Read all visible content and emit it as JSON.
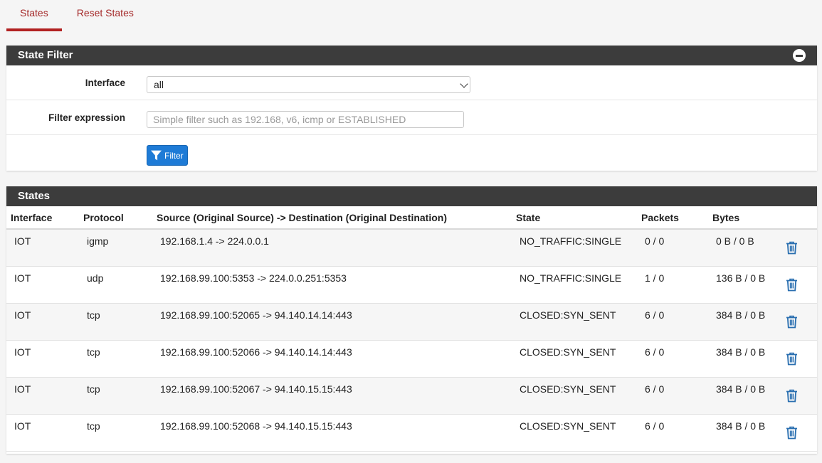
{
  "tabs": [
    {
      "label": "States",
      "active": true
    },
    {
      "label": "Reset States",
      "active": false
    }
  ],
  "filter_panel": {
    "title": "State Filter",
    "interface_label": "Interface",
    "interface_value": "all",
    "expression_label": "Filter expression",
    "expression_value": "",
    "expression_placeholder": "Simple filter such as 192.168, v6, icmp or ESTABLISHED",
    "filter_button": "Filter",
    "collapse_icon": "minus-circle-icon"
  },
  "states_panel": {
    "title": "States",
    "columns": [
      "Interface",
      "Protocol",
      "Source (Original Source) -> Destination (Original Destination)",
      "State",
      "Packets",
      "Bytes"
    ],
    "rows": [
      {
        "interface": "IOT",
        "protocol": "igmp",
        "connection": "192.168.1.4 -> 224.0.0.1",
        "state": "NO_TRAFFIC:SINGLE",
        "packets": "0 / 0",
        "bytes": "0 B / 0 B"
      },
      {
        "interface": "IOT",
        "protocol": "udp",
        "connection": "192.168.99.100:5353 -> 224.0.0.251:5353",
        "state": "NO_TRAFFIC:SINGLE",
        "packets": "1 / 0",
        "bytes": "136 B / 0 B"
      },
      {
        "interface": "IOT",
        "protocol": "tcp",
        "connection": "192.168.99.100:52065 -> 94.140.14.14:443",
        "state": "CLOSED:SYN_SENT",
        "packets": "6 / 0",
        "bytes": "384 B / 0 B"
      },
      {
        "interface": "IOT",
        "protocol": "tcp",
        "connection": "192.168.99.100:52066 -> 94.140.14.14:443",
        "state": "CLOSED:SYN_SENT",
        "packets": "6 / 0",
        "bytes": "384 B / 0 B"
      },
      {
        "interface": "IOT",
        "protocol": "tcp",
        "connection": "192.168.99.100:52067 -> 94.140.15.15:443",
        "state": "CLOSED:SYN_SENT",
        "packets": "6 / 0",
        "bytes": "384 B / 0 B"
      },
      {
        "interface": "IOT",
        "protocol": "tcp",
        "connection": "192.168.99.100:52068 -> 94.140.15.15:443",
        "state": "CLOSED:SYN_SENT",
        "packets": "6 / 0",
        "bytes": "384 B / 0 B"
      }
    ],
    "row_action_icon": "trash-icon"
  },
  "colors": {
    "accent": "#b22222",
    "header_bg": "#3c3c3c",
    "button_blue": "#1e7bd6",
    "trash_blue": "#2a6fb0"
  }
}
